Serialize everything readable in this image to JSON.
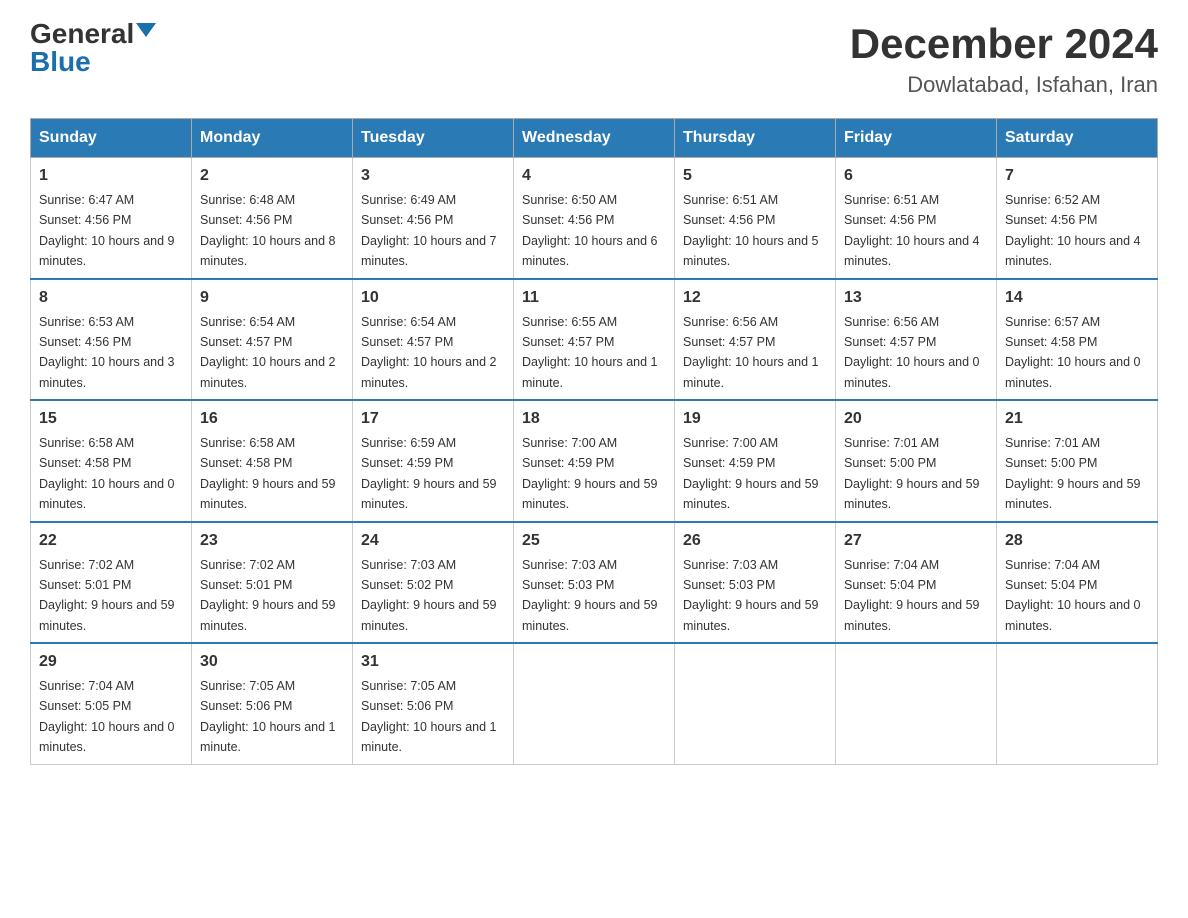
{
  "logo": {
    "general": "General",
    "blue": "Blue"
  },
  "title": {
    "month_year": "December 2024",
    "location": "Dowlatabad, Isfahan, Iran"
  },
  "headers": [
    "Sunday",
    "Monday",
    "Tuesday",
    "Wednesday",
    "Thursday",
    "Friday",
    "Saturday"
  ],
  "weeks": [
    [
      {
        "day": "1",
        "sunrise": "6:47 AM",
        "sunset": "4:56 PM",
        "daylight": "10 hours and 9 minutes."
      },
      {
        "day": "2",
        "sunrise": "6:48 AM",
        "sunset": "4:56 PM",
        "daylight": "10 hours and 8 minutes."
      },
      {
        "day": "3",
        "sunrise": "6:49 AM",
        "sunset": "4:56 PM",
        "daylight": "10 hours and 7 minutes."
      },
      {
        "day": "4",
        "sunrise": "6:50 AM",
        "sunset": "4:56 PM",
        "daylight": "10 hours and 6 minutes."
      },
      {
        "day": "5",
        "sunrise": "6:51 AM",
        "sunset": "4:56 PM",
        "daylight": "10 hours and 5 minutes."
      },
      {
        "day": "6",
        "sunrise": "6:51 AM",
        "sunset": "4:56 PM",
        "daylight": "10 hours and 4 minutes."
      },
      {
        "day": "7",
        "sunrise": "6:52 AM",
        "sunset": "4:56 PM",
        "daylight": "10 hours and 4 minutes."
      }
    ],
    [
      {
        "day": "8",
        "sunrise": "6:53 AM",
        "sunset": "4:56 PM",
        "daylight": "10 hours and 3 minutes."
      },
      {
        "day": "9",
        "sunrise": "6:54 AM",
        "sunset": "4:57 PM",
        "daylight": "10 hours and 2 minutes."
      },
      {
        "day": "10",
        "sunrise": "6:54 AM",
        "sunset": "4:57 PM",
        "daylight": "10 hours and 2 minutes."
      },
      {
        "day": "11",
        "sunrise": "6:55 AM",
        "sunset": "4:57 PM",
        "daylight": "10 hours and 1 minute."
      },
      {
        "day": "12",
        "sunrise": "6:56 AM",
        "sunset": "4:57 PM",
        "daylight": "10 hours and 1 minute."
      },
      {
        "day": "13",
        "sunrise": "6:56 AM",
        "sunset": "4:57 PM",
        "daylight": "10 hours and 0 minutes."
      },
      {
        "day": "14",
        "sunrise": "6:57 AM",
        "sunset": "4:58 PM",
        "daylight": "10 hours and 0 minutes."
      }
    ],
    [
      {
        "day": "15",
        "sunrise": "6:58 AM",
        "sunset": "4:58 PM",
        "daylight": "10 hours and 0 minutes."
      },
      {
        "day": "16",
        "sunrise": "6:58 AM",
        "sunset": "4:58 PM",
        "daylight": "9 hours and 59 minutes."
      },
      {
        "day": "17",
        "sunrise": "6:59 AM",
        "sunset": "4:59 PM",
        "daylight": "9 hours and 59 minutes."
      },
      {
        "day": "18",
        "sunrise": "7:00 AM",
        "sunset": "4:59 PM",
        "daylight": "9 hours and 59 minutes."
      },
      {
        "day": "19",
        "sunrise": "7:00 AM",
        "sunset": "4:59 PM",
        "daylight": "9 hours and 59 minutes."
      },
      {
        "day": "20",
        "sunrise": "7:01 AM",
        "sunset": "5:00 PM",
        "daylight": "9 hours and 59 minutes."
      },
      {
        "day": "21",
        "sunrise": "7:01 AM",
        "sunset": "5:00 PM",
        "daylight": "9 hours and 59 minutes."
      }
    ],
    [
      {
        "day": "22",
        "sunrise": "7:02 AM",
        "sunset": "5:01 PM",
        "daylight": "9 hours and 59 minutes."
      },
      {
        "day": "23",
        "sunrise": "7:02 AM",
        "sunset": "5:01 PM",
        "daylight": "9 hours and 59 minutes."
      },
      {
        "day": "24",
        "sunrise": "7:03 AM",
        "sunset": "5:02 PM",
        "daylight": "9 hours and 59 minutes."
      },
      {
        "day": "25",
        "sunrise": "7:03 AM",
        "sunset": "5:03 PM",
        "daylight": "9 hours and 59 minutes."
      },
      {
        "day": "26",
        "sunrise": "7:03 AM",
        "sunset": "5:03 PM",
        "daylight": "9 hours and 59 minutes."
      },
      {
        "day": "27",
        "sunrise": "7:04 AM",
        "sunset": "5:04 PM",
        "daylight": "9 hours and 59 minutes."
      },
      {
        "day": "28",
        "sunrise": "7:04 AM",
        "sunset": "5:04 PM",
        "daylight": "10 hours and 0 minutes."
      }
    ],
    [
      {
        "day": "29",
        "sunrise": "7:04 AM",
        "sunset": "5:05 PM",
        "daylight": "10 hours and 0 minutes."
      },
      {
        "day": "30",
        "sunrise": "7:05 AM",
        "sunset": "5:06 PM",
        "daylight": "10 hours and 1 minute."
      },
      {
        "day": "31",
        "sunrise": "7:05 AM",
        "sunset": "5:06 PM",
        "daylight": "10 hours and 1 minute."
      },
      null,
      null,
      null,
      null
    ]
  ]
}
